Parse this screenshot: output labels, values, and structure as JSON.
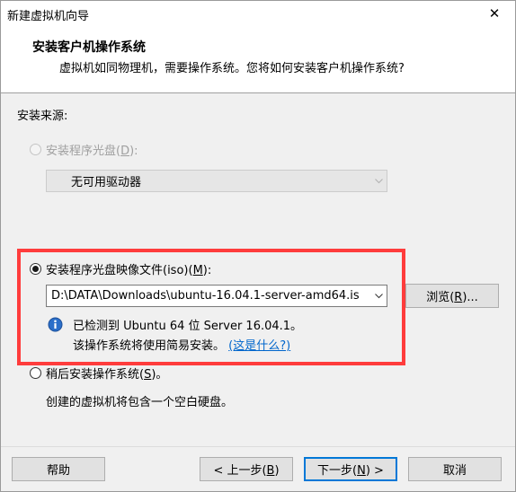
{
  "window": {
    "title": "新建虚拟机向导",
    "close_glyph": "✕"
  },
  "header": {
    "title": "安装客户机操作系统",
    "subtitle": "虚拟机如同物理机，需要操作系统。您将如何安装客户机操作系统?"
  },
  "install_source": {
    "label": "安装来源:",
    "disc_option": {
      "label_prefix": "安装程序光盘(",
      "hotkey": "D",
      "label_suffix": "):",
      "enabled": false,
      "selected": false
    },
    "disc_drive": {
      "value": "无可用驱动器",
      "enabled": false
    },
    "iso_option": {
      "label_prefix": "安装程序光盘映像文件(iso)(",
      "hotkey": "M",
      "label_suffix": "):",
      "enabled": true,
      "selected": true
    },
    "iso_path": {
      "value": "D:\\DATA\\Downloads\\ubuntu-16.04.1-server-amd64.is"
    },
    "browse_button": {
      "label_prefix": "浏览(",
      "hotkey": "R",
      "label_suffix": ")..."
    },
    "detect_line1": "已检测到 Ubuntu 64 位 Server 16.04.1。",
    "detect_line2": "该操作系统将使用简易安装。",
    "what_link": "(这是什么?)",
    "later_option": {
      "label_prefix": "稍后安装操作系统(",
      "hotkey": "S",
      "label_suffix": ")。",
      "enabled": true,
      "selected": false
    },
    "later_desc": "创建的虚拟机将包含一个空白硬盘。"
  },
  "footer": {
    "help_label": "帮助",
    "back": {
      "prefix": "< 上一步(",
      "hotkey": "B",
      "suffix": ")"
    },
    "next": {
      "prefix": "下一步(",
      "hotkey": "N",
      "suffix": ") >"
    },
    "cancel_label": "取消"
  },
  "colors": {
    "highlight_border": "#ff3c3c",
    "link": "#0066cc",
    "focus_border": "#0078d7",
    "info_icon": "#2b6fc9"
  },
  "icons": [
    "close-icon",
    "dropdown-arrow-icon",
    "info-icon"
  ]
}
